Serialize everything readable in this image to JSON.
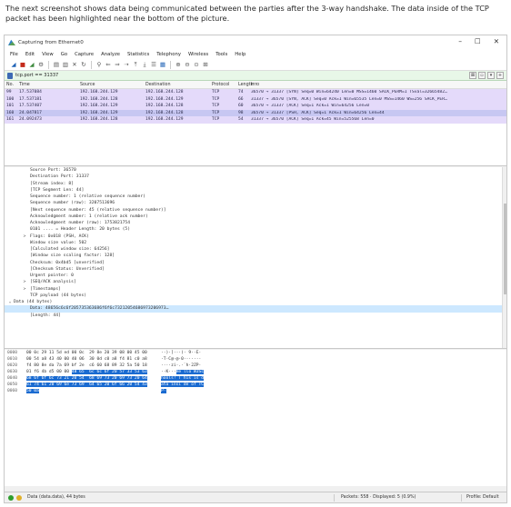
{
  "caption": "The next screenshot shows data being communicated between the parties after the 3-way handshake. The data inside of the TCP packet has been highlighted near the bottom of the picture.",
  "window": {
    "title": "Capturing from Ethernet0",
    "controls": [
      "–",
      "☐",
      "✕"
    ]
  },
  "menu": [
    "File",
    "Edit",
    "View",
    "Go",
    "Capture",
    "Analyze",
    "Statistics",
    "Telephony",
    "Wireless",
    "Tools",
    "Help"
  ],
  "toolbar_icons": [
    "shark-fin-icon",
    "stop-icon",
    "restart-icon",
    "options-icon",
    "open-icon",
    "save-icon",
    "close-file-icon",
    "reload-icon",
    "find-icon",
    "back-icon",
    "forward-icon",
    "goto-icon",
    "first-icon",
    "last-icon",
    "autoscroll-icon",
    "colorize-icon",
    "zoom-in-icon",
    "zoom-out-icon",
    "zoom-reset-icon",
    "resize-columns-icon"
  ],
  "filter": {
    "value": "tcp.port == 31337",
    "buttons": [
      "⊠",
      "▫",
      "▾",
      "+"
    ]
  },
  "packet_list": {
    "headers": [
      "No.",
      "Time",
      "Source",
      "Destination",
      "Protocol",
      "Length",
      "Info"
    ],
    "rows": [
      {
        "no": "99",
        "time": "17.537084",
        "src": "192.168.244.129",
        "dst": "192.168.244.128",
        "proto": "TCP",
        "len": "74",
        "info": "36570 → 31337 [SYN] Seq=0 Win=64240 Len=0 MSS=1460 SACK_PERM=1 TSval=32665482…"
      },
      {
        "no": "100",
        "time": "17.537181",
        "src": "192.168.244.128",
        "dst": "192.168.244.129",
        "proto": "TCP",
        "len": "66",
        "info": "31337 → 36570 [SYN, ACK] Seq=0 Ack=1 Win=65535 Len=0 MSS=1460 WS=256 SACK_PER…"
      },
      {
        "no": "101",
        "time": "17.537407",
        "src": "192.168.244.129",
        "dst": "192.168.244.128",
        "proto": "TCP",
        "len": "60",
        "info": "36570 → 31337 [ACK] Seq=1 Ack=1 Win=64256 Len=0"
      },
      {
        "no": "160",
        "time": "24.047817",
        "src": "192.168.244.129",
        "dst": "192.168.244.128",
        "proto": "TCP",
        "len": "98",
        "info": "36570 → 31337 [PSH, ACK] Seq=1 Ack=1 Win=64256 Len=44"
      },
      {
        "no": "161",
        "time": "24.092473",
        "src": "192.168.244.128",
        "dst": "192.168.244.129",
        "proto": "TCP",
        "len": "54",
        "info": "31337 → 36570 [ACK] Seq=1 Ack=45 Win=525568 Len=0"
      }
    ]
  },
  "details": [
    {
      "indent": 1,
      "arrow": "",
      "text": "Source Port: 36570"
    },
    {
      "indent": 1,
      "arrow": "",
      "text": "Destination Port: 31337"
    },
    {
      "indent": 1,
      "arrow": "",
      "text": "[Stream index: 8]"
    },
    {
      "indent": 1,
      "arrow": "",
      "text": "[TCP Segment Len: 44]"
    },
    {
      "indent": 1,
      "arrow": "",
      "text": "Sequence number: 1    (relative sequence number)"
    },
    {
      "indent": 1,
      "arrow": "",
      "text": "Sequence number (raw): 3207513696"
    },
    {
      "indent": 1,
      "arrow": "",
      "text": "[Next sequence number: 45    (relative sequence number)]"
    },
    {
      "indent": 1,
      "arrow": "",
      "text": "Acknowledgment number: 1    (relative ack number)"
    },
    {
      "indent": 1,
      "arrow": "",
      "text": "Acknowledgment number (raw): 1753821754"
    },
    {
      "indent": 1,
      "arrow": "",
      "text": "0101 .... = Header Length: 20 bytes (5)"
    },
    {
      "indent": 1,
      "arrow": ">",
      "text": "Flags: 0x018 (PSH, ACK)"
    },
    {
      "indent": 1,
      "arrow": "",
      "text": "Window size value: 502"
    },
    {
      "indent": 1,
      "arrow": "",
      "text": "[Calculated window size: 64256]"
    },
    {
      "indent": 1,
      "arrow": "",
      "text": "[Window size scaling factor: 128]"
    },
    {
      "indent": 1,
      "arrow": "",
      "text": "Checksum: 0x4bd5 [unverified]"
    },
    {
      "indent": 1,
      "arrow": "",
      "text": "[Checksum Status: Unverified]"
    },
    {
      "indent": 1,
      "arrow": "",
      "text": "Urgent pointer: 0"
    },
    {
      "indent": 1,
      "arrow": ">",
      "text": "[SEQ/ACK analysis]"
    },
    {
      "indent": 1,
      "arrow": ">",
      "text": "[Timestamps]"
    },
    {
      "indent": 1,
      "arrow": "",
      "text": "TCP payload (44 bytes)"
    },
    {
      "indent": 0,
      "arrow": "v",
      "text": "Data (44 bytes)"
    },
    {
      "indent": 1,
      "arrow": "",
      "text": "Data: 48656c6c6f205735363686f6f6c73212054686973206973…",
      "highlight": true
    },
    {
      "indent": 1,
      "arrow": "",
      "text": "[Length: 44]"
    }
  ],
  "bytes": [
    {
      "off": "0000",
      "hex": [
        [
          "00 0c 29 11 5d ed 00 0c  29 8e 20 39 08 00 45 00",
          false
        ]
      ],
      "ascii": [
        [
          "··)·]···)· 9··E·",
          false
        ]
      ]
    },
    {
      "off": "0010",
      "hex": [
        [
          "00 54 a8 43 40 00 40 06  30 0d c0 a8 f4 81 c0 a8",
          false
        ]
      ],
      "ascii": [
        [
          "·T·C@·@·0·······",
          false
        ]
      ]
    },
    {
      "off": "0020",
      "hex": [
        [
          "f4 80 8e da 7a 69 bf 2e  c6 60 68 89 32 5a 50 18",
          false
        ]
      ],
      "ascii": [
        [
          "····zi·.·`h·2ZP·",
          false
        ]
      ]
    },
    {
      "off": "0030",
      "hex": [
        [
          "01 f6 4b d5 00 00 ",
          false
        ],
        [
          "48 65  6c 6c 6f 20 57 33 53 63",
          true
        ]
      ],
      "ascii": [
        [
          "··K···",
          false
        ],
        [
          "He llo W3Sc",
          true
        ]
      ]
    },
    {
      "off": "0040",
      "hex": [
        [
          "68 6f 6f 6c 73 21 20 54  68 69 73 20 69 73 20 64",
          true
        ]
      ],
      "ascii": [
        [
          "hools! T his is d",
          true
        ]
      ]
    },
    {
      "off": "0050",
      "hex": [
        [
          "61 74 61 20 69 6e 73 69  64 65 20 6f 66 20 54 43",
          true
        ]
      ],
      "ascii": [
        [
          "ata insi de of TC",
          true
        ]
      ]
    },
    {
      "off": "0060",
      "hex": [
        [
          "50 0a",
          true
        ]
      ],
      "ascii": [
        [
          "P·",
          true
        ]
      ]
    }
  ],
  "status": {
    "left": "Data (data.data), 44 bytes",
    "middle": "Packets: 558 · Displayed: 5 (0.9%)",
    "right": "Profile: Default",
    "colors": {
      "ok": "#2f9e2f",
      "warn": "#e0b02a"
    }
  }
}
